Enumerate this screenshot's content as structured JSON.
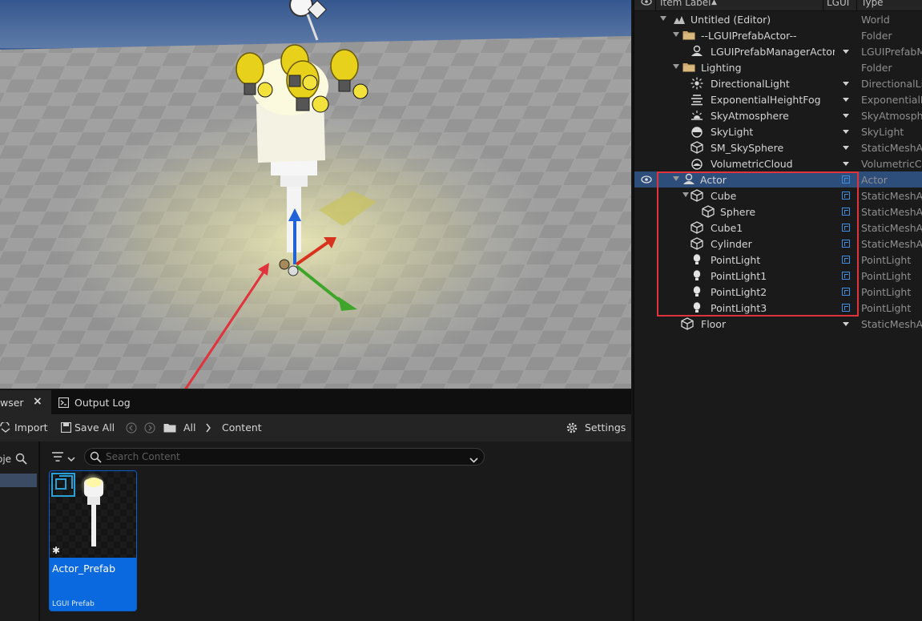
{
  "outliner": {
    "headers": {
      "label": "Item Label",
      "sort": "▲",
      "lgui": "LGUI",
      "type": "Type"
    },
    "rows": [
      {
        "label": "Untitled (Editor)",
        "type": "World",
        "icon": "world-icon"
      },
      {
        "label": "--LGUIPrefabActor--",
        "type": "Folder",
        "icon": "folder-icon"
      },
      {
        "label": "LGUIPrefabManagerActor",
        "type": "LGUIPrefabManagerActor",
        "icon": "actor-icon"
      },
      {
        "label": "Lighting",
        "type": "Folder",
        "icon": "folder-icon"
      },
      {
        "label": "DirectionalLight",
        "type": "DirectionalLight",
        "icon": "sun-icon"
      },
      {
        "label": "ExponentialHeightFog",
        "type": "ExponentialHeightFog",
        "icon": "fog-icon"
      },
      {
        "label": "SkyAtmosphere",
        "type": "SkyAtmosphere",
        "icon": "sky-atmosphere-icon"
      },
      {
        "label": "SkyLight",
        "type": "SkyLight",
        "icon": "sky-light-icon"
      },
      {
        "label": "SM_SkySphere",
        "type": "StaticMeshActor",
        "icon": "static-mesh-icon"
      },
      {
        "label": "VolumetricCloud",
        "type": "VolumetricCloud",
        "icon": "cloud-icon"
      },
      {
        "label": "Actor",
        "type": "Actor",
        "icon": "actor-icon"
      },
      {
        "label": "Cube",
        "type": "StaticMeshActor",
        "icon": "static-mesh-icon"
      },
      {
        "label": "Sphere",
        "type": "StaticMeshActor",
        "icon": "static-mesh-icon"
      },
      {
        "label": "Cube1",
        "type": "StaticMeshActor",
        "icon": "static-mesh-icon"
      },
      {
        "label": "Cylinder",
        "type": "StaticMeshActor",
        "icon": "static-mesh-icon"
      },
      {
        "label": "PointLight",
        "type": "PointLight",
        "icon": "bulb-icon"
      },
      {
        "label": "PointLight1",
        "type": "PointLight",
        "icon": "bulb-icon"
      },
      {
        "label": "PointLight2",
        "type": "PointLight",
        "icon": "bulb-icon"
      },
      {
        "label": "PointLight3",
        "type": "PointLight",
        "icon": "bulb-icon"
      },
      {
        "label": "Floor",
        "type": "StaticMeshActor",
        "icon": "static-mesh-icon"
      }
    ]
  },
  "tabs": {
    "content_browser": "wser",
    "output_log": "Output Log",
    "close": "×"
  },
  "toolbar": {
    "import": "Import",
    "save_all": "Save All",
    "path_all": "All",
    "path_content": "Content",
    "settings": "Settings",
    "sidebar_label": "oje"
  },
  "search": {
    "placeholder": "Search Content"
  },
  "asset": {
    "name": "Actor_Prefab",
    "type": "LGUI Prefab"
  },
  "colors": {
    "accent": "#0b69df",
    "highlight": "#e0333b",
    "selection": "#2d4d7a"
  }
}
